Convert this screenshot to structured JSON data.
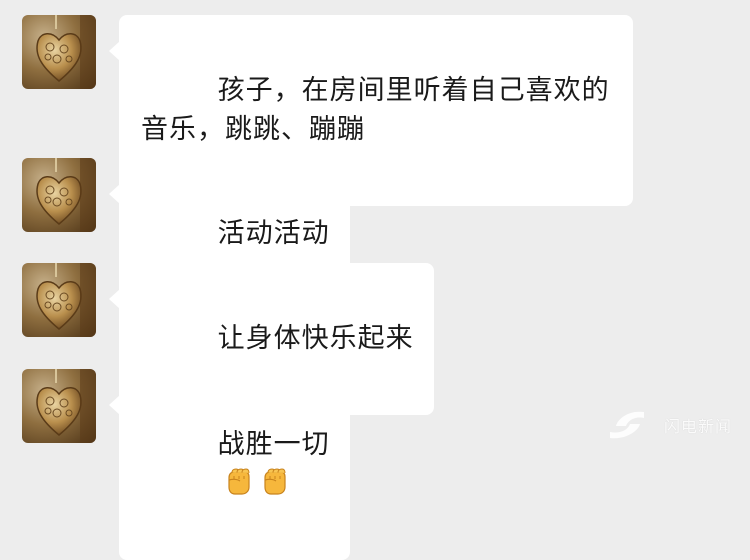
{
  "messages": [
    {
      "text": "孩子，在房间里听着自己喜欢的音乐，跳跳、蹦蹦"
    },
    {
      "text": "活动活动"
    },
    {
      "text": "让身体快乐起来"
    },
    {
      "text": "战胜一切",
      "emojis": [
        "fist-emoji",
        "fist-emoji"
      ]
    }
  ],
  "avatar_icon": "heart-locket-avatar",
  "watermark": {
    "text": "闪电新闻",
    "logo": "lightning-logo"
  }
}
